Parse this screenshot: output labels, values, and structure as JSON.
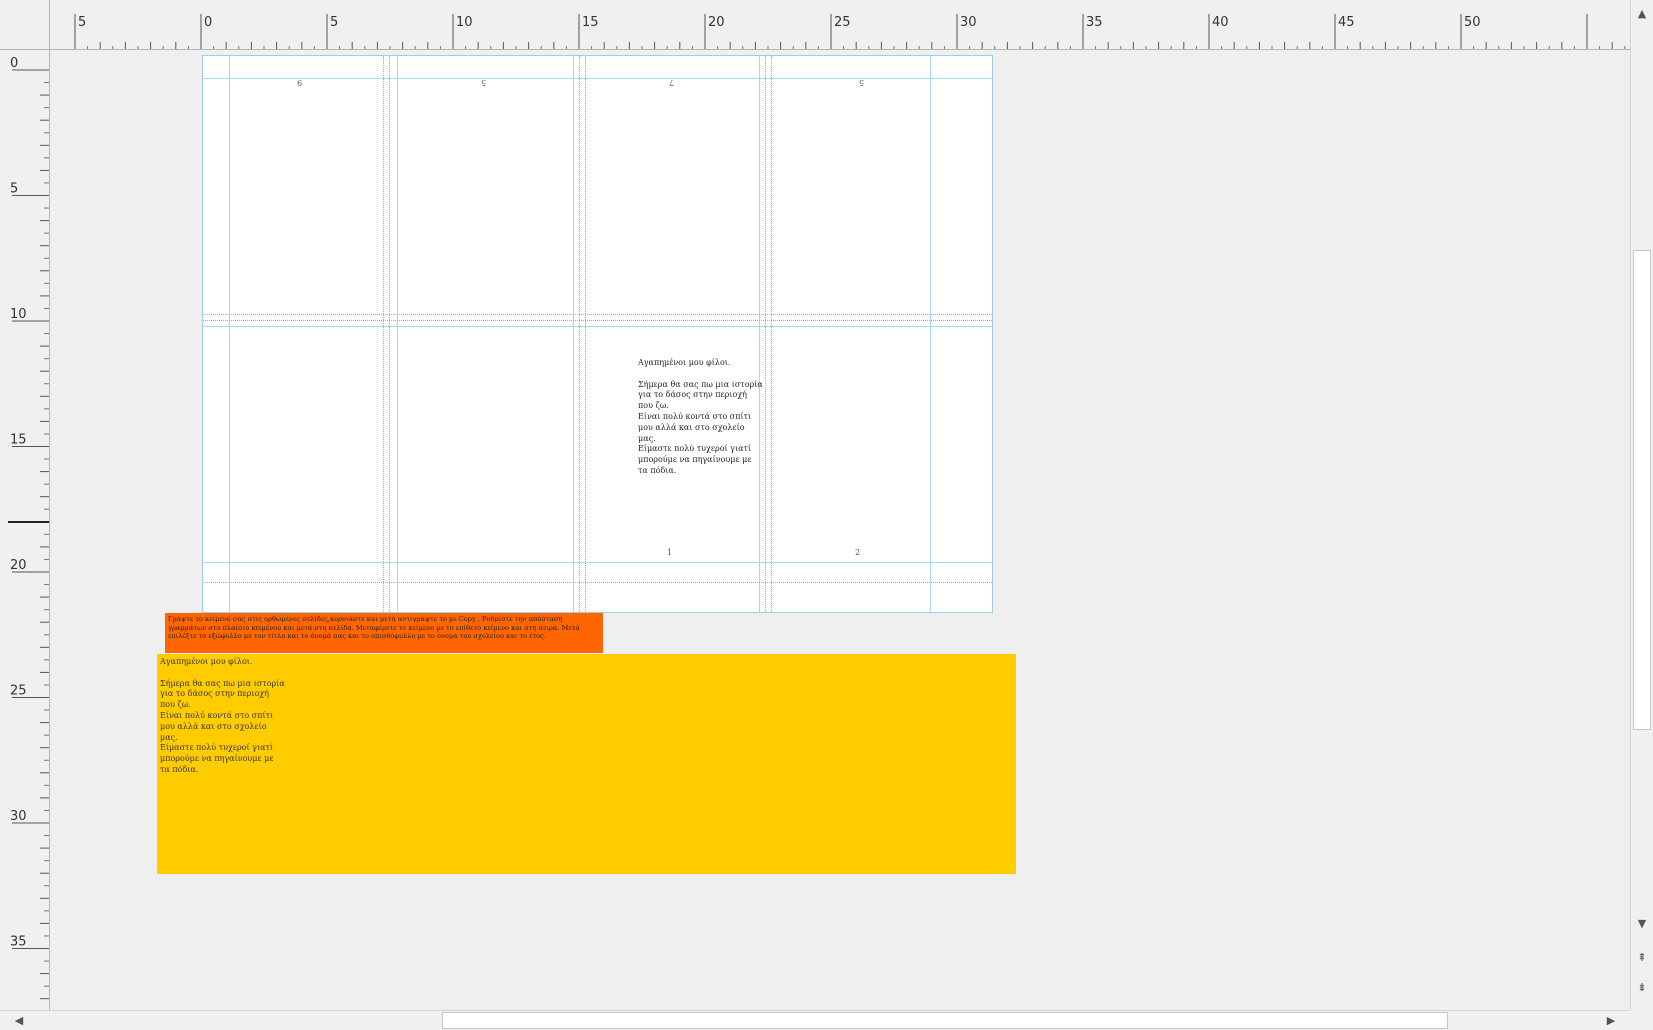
{
  "rulers": {
    "horizontal_labels": [
      "5",
      "0",
      "5",
      "10",
      "15",
      "20",
      "25",
      "30",
      "35",
      "40",
      "45",
      "50"
    ],
    "vertical_labels": [
      "0",
      "5",
      "10",
      "15",
      "20",
      "25",
      "30",
      "35"
    ]
  },
  "page": {
    "page_numbers_top": [
      "9",
      "5",
      "7",
      "5"
    ],
    "page_numbers_bottom": [
      "1",
      "2"
    ],
    "letter_text": "Αγαπημένοι μου φίλοι.\n\nΣήμερα θα σας πω μια ιστορία\nγια το δάσος στην περιοχή\nπου ζω.\nΕίναι πολύ κοντά στο σπίτι\nμου αλλά και στο σχολείο\nμας.\nΕίμαστε πολύ τυχεροί γιατί\nμπορούμε να πηγαίνουμε με\nτα πόδια."
  },
  "note": {
    "text": "Γράψτε το κείμενό σας στις ορθωμένες σελίδες,κορνιάστε και μετά αντιγράψτε το με Copy . Ρυθμίστε την απόσταση γραμμάτων στο πλαίσιο κειμένου και μετά στη σελίδα. Μεταφέρετε το κείμενο με το επίθετο κείμενο και στη σειρά. Μετά επιλέξτε το εξώφυλλο με τον τίτλο και το όνομά σας και το οπισθόφυλλο με το όνομα του σχολείου και το έτος."
  },
  "cards": {
    "first_text": "Αγαπημένοι μου φίλοι.\n\nΣήμερα θα σας πω μια ιστορία\nγια το δάσος στην περιοχή\nπου ζω.\nΕίναι πολύ κοντά στο σπίτι\nμου αλλά και στο σχολείο\nμας.\nΕίμαστε πολύ τυχεροί γιατί\nμπορούμε να πηγαίνουμε με\nτα πόδια."
  },
  "colors": {
    "note_bg": "#ff6600",
    "card_bg": "#ffcc00",
    "guide": "#7fb7dc"
  },
  "icons": {
    "scroll_up": "triangle-up-icon",
    "scroll_down": "triangle-down-icon",
    "page_up": "double-arrow-up-icon",
    "page_down": "double-arrow-down-icon",
    "scroll_left": "triangle-left-icon",
    "scroll_right": "triangle-right-icon"
  }
}
